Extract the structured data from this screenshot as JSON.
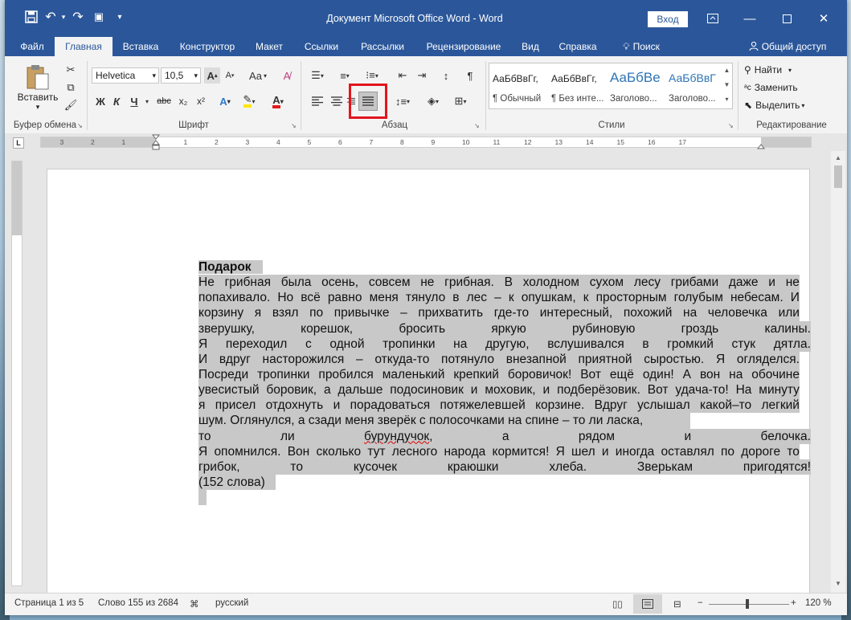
{
  "window": {
    "title": "Документ Microsoft Office Word  -  Word",
    "signin": "Вход"
  },
  "tabs": [
    "Файл",
    "Главная",
    "Вставка",
    "Конструктор",
    "Макет",
    "Ссылки",
    "Рассылки",
    "Рецензирование",
    "Вид",
    "Справка",
    "Поиск",
    "Общий доступ"
  ],
  "ribbon": {
    "clipboard": {
      "paste": "Вставить",
      "label": "Буфер обмена"
    },
    "font": {
      "name": "Helvetica",
      "size": "10,5",
      "label": "Шрифт",
      "bold": "Ж",
      "italic": "К",
      "underline": "Ч",
      "strike": "abc",
      "sub": "x₂",
      "sup": "x²",
      "case": "Аа",
      "grow": "A",
      "shrink": "A"
    },
    "paragraph": {
      "label": "Абзац"
    },
    "styles": {
      "label": "Стили",
      "items": [
        {
          "sample": "АаБбВвГг,",
          "name": "¶ Обычный"
        },
        {
          "sample": "АаБбВвГг,",
          "name": "¶ Без инте..."
        },
        {
          "sample": "АаБбВе",
          "name": "Заголово..."
        },
        {
          "sample": "АаБбВвГ",
          "name": "Заголово..."
        }
      ]
    },
    "editing": {
      "find": "Найти",
      "replace": "Заменить",
      "select": "Выделить",
      "label": "Редактирование"
    }
  },
  "ruler": {
    "ticks": [
      "3",
      "2",
      "1",
      "1",
      "2",
      "3",
      "4",
      "5",
      "6",
      "7",
      "8",
      "9",
      "10",
      "11",
      "12",
      "13",
      "14",
      "15",
      "16",
      "17"
    ]
  },
  "document": {
    "title": "Подарок",
    "lines": [
      "Не грибная была осень, совсем не грибная. В холодном сухом лесу грибами даже и не",
      "попахивало. Но всё равно меня тянуло в лес – к опушкам, к просторным голубым небесам. И",
      "корзину я взял по привычке – прихватить где-то интересный, похожий на человечка или",
      "зверушку, корешок, бросить яркую рубиновую гроздь калины.",
      "Я переходил с одной тропинки на другую, вслушивался в громкий стук дятла.",
      "И вдруг насторожился – откуда-то потянуло внезапной приятной сыростью. Я огляделся.",
      "Посреди тропинки пробился маленький крепкий боровичок! Вот ещё один! А вон на обочине",
      "увесистый боровик, а дальше подосиновик и моховик, и подберёзовик. Вот удача-то! На минуту",
      "я присел отдохнуть и порадоваться потяжелевшей корзине. Вдруг услышал какой–то легкий",
      "шум. Оглянулся, а сзади меня зверёк с полосочками на спине – то ли ласка,",
      "то ли бурундучок, а рядом и белочка.",
      "Я опомнился. Вон сколько тут лесного народа кормится! Я шел и иногда оставлял по дороге то",
      "грибок, то кусочек краюшки хлеба. Зверькам пригодятся!",
      "(152 слова)"
    ]
  },
  "status": {
    "page": "Страница 1 из 5",
    "words": "Слово 155 из 2684",
    "language": "русский",
    "zoom": "120 %"
  },
  "colors": {
    "accent": "#2b579a",
    "selection": "#c8c8c8",
    "highlight_box": "#e3141c"
  }
}
